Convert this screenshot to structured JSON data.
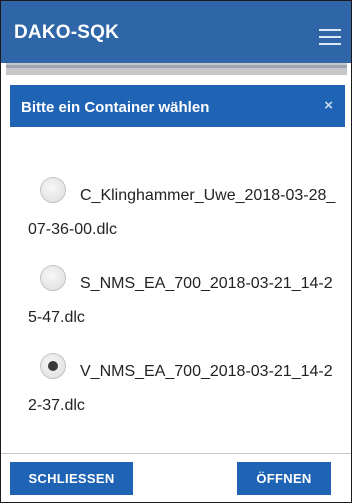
{
  "app": {
    "title": "DAKO-SQK",
    "menu_icon": "hamburger-menu-icon"
  },
  "dialog": {
    "title": "Bitte ein Container wählen",
    "close_symbol": "×",
    "options": [
      {
        "label": "C_Klinghammer_Uwe_2018-03-28_07-36-00.dlc",
        "checked": false
      },
      {
        "label": "S_NMS_EA_700_2018-03-21_14-25-47.dlc",
        "checked": false
      },
      {
        "label": "V_NMS_EA_700_2018-03-21_14-22-37.dlc",
        "checked": true
      }
    ],
    "buttons": {
      "close_label": "SCHLIESSEN",
      "open_label": "ÖFFNEN"
    }
  },
  "colors": {
    "appbar": "#2f66a8",
    "dialog_header": "#1f63b5",
    "button": "#1f63b5"
  }
}
